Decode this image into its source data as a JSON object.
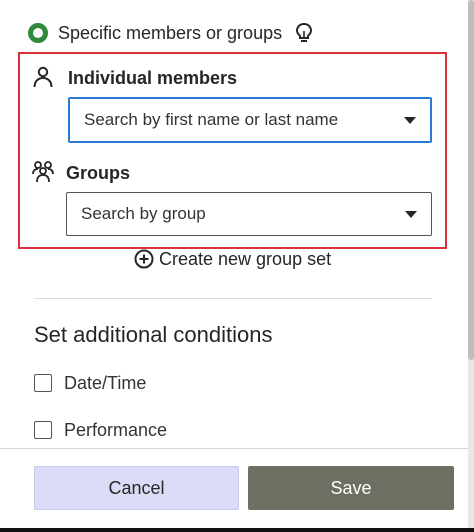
{
  "radio": {
    "label": "Specific members or groups",
    "selected": true,
    "icon": "lightbulb-icon"
  },
  "individual": {
    "label": "Individual members",
    "placeholder": "Search by first name or last name",
    "icon": "person-icon"
  },
  "groups": {
    "label": "Groups",
    "placeholder": "Search by group",
    "icon": "groups-icon"
  },
  "create_group": {
    "label": "Create new group set",
    "icon": "plus-circle-icon"
  },
  "conditions": {
    "heading": "Set additional conditions",
    "items": [
      {
        "label": "Date/Time",
        "checked": false
      },
      {
        "label": "Performance",
        "checked": false
      }
    ]
  },
  "footer": {
    "cancel_label": "Cancel",
    "save_label": "Save"
  },
  "colors": {
    "radio": "#2f8a3a",
    "highlight": "#d9323a",
    "focus": "#2a7bd4",
    "cancel_bg": "#dcdcf8",
    "save_bg": "#6e6f62"
  }
}
